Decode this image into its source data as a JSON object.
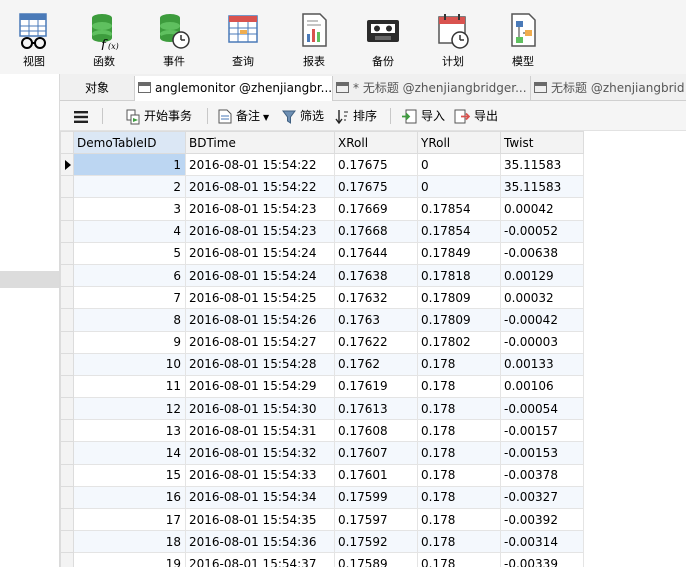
{
  "ribbon": {
    "items": [
      {
        "label": "视图"
      },
      {
        "label": "函数"
      },
      {
        "label": "事件"
      },
      {
        "label": "查询"
      },
      {
        "label": "报表"
      },
      {
        "label": "备份"
      },
      {
        "label": "计划"
      },
      {
        "label": "模型"
      }
    ]
  },
  "tabs": {
    "objects": "对象",
    "tab1": "anglemonitor @zhenjiangbr...",
    "tab2": "* 无标题 @zhenjiangbridger...",
    "tab3": "无标题 @zhenjiangbrid"
  },
  "toolbar": {
    "begin_transaction": "开始事务",
    "note": "备注",
    "filter": "筛选",
    "sort": "排序",
    "import": "导入",
    "export": "导出"
  },
  "grid": {
    "columns": [
      "DemoTableID",
      "BDTime",
      "XRoll",
      "YRoll",
      "Twist"
    ],
    "rows": [
      [
        "1",
        "2016-08-01 15:54:22",
        "0.17675",
        "0",
        "35.11583"
      ],
      [
        "2",
        "2016-08-01 15:54:22",
        "0.17675",
        "0",
        "35.11583"
      ],
      [
        "3",
        "2016-08-01 15:54:23",
        "0.17669",
        "0.17854",
        "0.00042"
      ],
      [
        "4",
        "2016-08-01 15:54:23",
        "0.17668",
        "0.17854",
        "-0.00052"
      ],
      [
        "5",
        "2016-08-01 15:54:24",
        "0.17644",
        "0.17849",
        "-0.00638"
      ],
      [
        "6",
        "2016-08-01 15:54:24",
        "0.17638",
        "0.17818",
        "0.00129"
      ],
      [
        "7",
        "2016-08-01 15:54:25",
        "0.17632",
        "0.17809",
        "0.00032"
      ],
      [
        "8",
        "2016-08-01 15:54:26",
        "0.1763",
        "0.17809",
        "-0.00042"
      ],
      [
        "9",
        "2016-08-01 15:54:27",
        "0.17622",
        "0.17802",
        "-0.00003"
      ],
      [
        "10",
        "2016-08-01 15:54:28",
        "0.1762",
        "0.178",
        "0.00133"
      ],
      [
        "11",
        "2016-08-01 15:54:29",
        "0.17619",
        "0.178",
        "0.00106"
      ],
      [
        "12",
        "2016-08-01 15:54:30",
        "0.17613",
        "0.178",
        "-0.00054"
      ],
      [
        "13",
        "2016-08-01 15:54:31",
        "0.17608",
        "0.178",
        "-0.00157"
      ],
      [
        "14",
        "2016-08-01 15:54:32",
        "0.17607",
        "0.178",
        "-0.00153"
      ],
      [
        "15",
        "2016-08-01 15:54:33",
        "0.17601",
        "0.178",
        "-0.00378"
      ],
      [
        "16",
        "2016-08-01 15:54:34",
        "0.17599",
        "0.178",
        "-0.00327"
      ],
      [
        "17",
        "2016-08-01 15:54:35",
        "0.17597",
        "0.178",
        "-0.00392"
      ],
      [
        "18",
        "2016-08-01 15:54:36",
        "0.17592",
        "0.178",
        "-0.00314"
      ],
      [
        "19",
        "2016-08-01 15:54:37",
        "0.17589",
        "0.178",
        "-0.00339"
      ]
    ]
  }
}
